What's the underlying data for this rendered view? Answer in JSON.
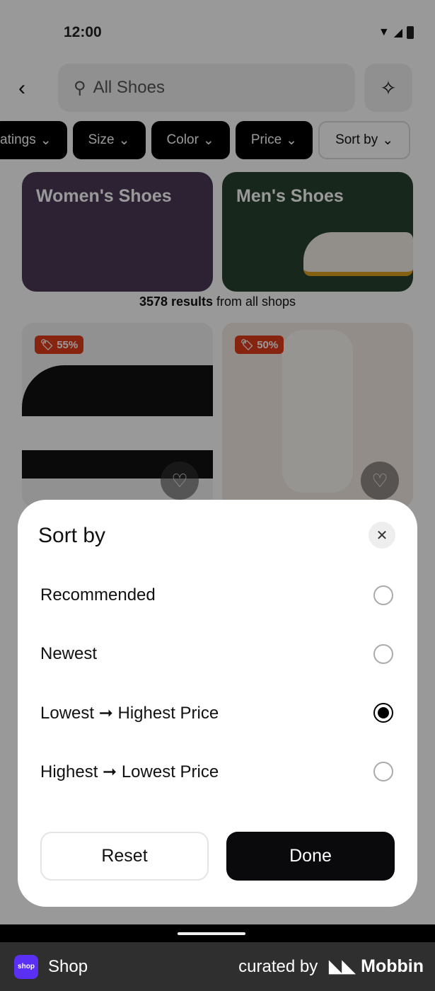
{
  "status": {
    "time": "12:00"
  },
  "header": {
    "search_placeholder": "All Shoes"
  },
  "filters": [
    "atings",
    "Size",
    "Color",
    "Price",
    "Sort by"
  ],
  "categories": [
    {
      "label": "Women's Shoes",
      "color": "#4a3a55"
    },
    {
      "label": "Men's Shoes",
      "color": "#28412f"
    }
  ],
  "results": {
    "count": "3578 results",
    "suffix": " from all shops"
  },
  "products": [
    {
      "discount": "55%"
    },
    {
      "discount": "50%"
    }
  ],
  "sheet": {
    "title": "Sort by",
    "options": [
      {
        "label": "Recommended",
        "selected": false
      },
      {
        "label": "Newest",
        "selected": false
      },
      {
        "label": "Lowest ➞ Highest Price",
        "selected": true
      },
      {
        "label": "Highest ➞ Lowest Price",
        "selected": false
      }
    ],
    "reset_label": "Reset",
    "done_label": "Done"
  },
  "footer": {
    "app_logo": "shop",
    "app_name": "Shop",
    "curated": "curated by",
    "brand": "Mobbin"
  }
}
